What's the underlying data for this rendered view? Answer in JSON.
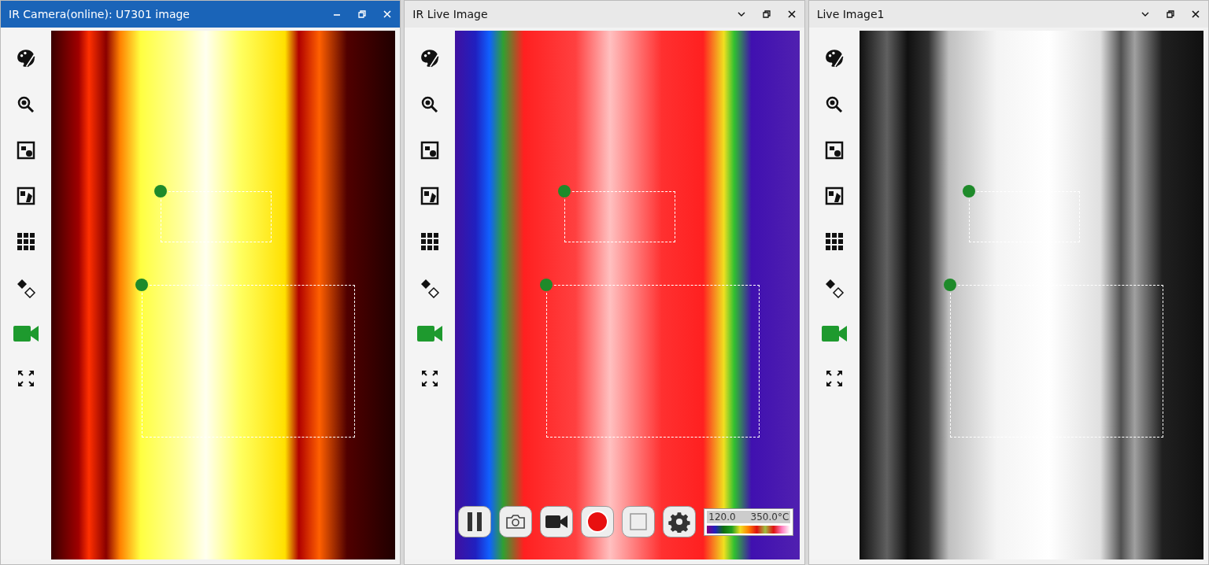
{
  "windows": [
    {
      "title": "IR Camera(online): U7301 image",
      "active": true,
      "image": {
        "kind": "iron"
      },
      "caption_buttons": [
        {
          "kind": "minimize"
        },
        {
          "kind": "restore"
        },
        {
          "kind": "close"
        }
      ]
    },
    {
      "title": "IR Live Image",
      "active": false,
      "image": {
        "kind": "rainbow"
      },
      "caption_buttons": [
        {
          "kind": "chevron"
        },
        {
          "kind": "restore"
        },
        {
          "kind": "close"
        }
      ],
      "controls": {
        "scale": {
          "min": "120.0",
          "max": "350.0°C"
        }
      }
    },
    {
      "title": "Live Image1",
      "active": false,
      "image": {
        "kind": "gray"
      },
      "caption_buttons": [
        {
          "kind": "chevron"
        },
        {
          "kind": "restore"
        },
        {
          "kind": "close"
        }
      ]
    }
  ]
}
